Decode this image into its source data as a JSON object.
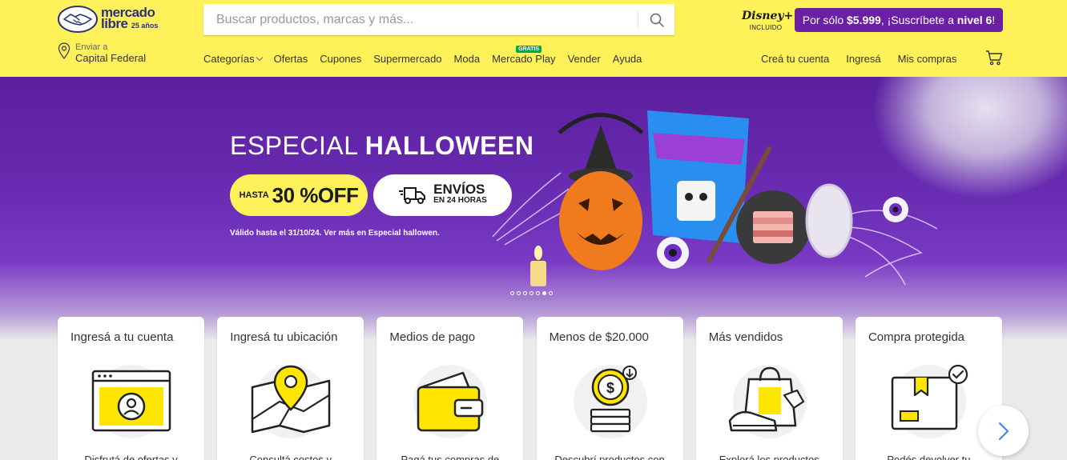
{
  "header": {
    "logo": {
      "line1": "mercado",
      "line2": "libre",
      "anniversary": "25 años"
    },
    "search": {
      "placeholder": "Buscar productos, marcas y más..."
    },
    "disney": {
      "brand": "Disney+",
      "tag": "INCLUIDO"
    },
    "promo": {
      "prefix": "Por sólo ",
      "price": "$5.999",
      "middle": ", ¡Suscríbete a ",
      "level": "nivel 6",
      "suffix": "!"
    },
    "location": {
      "label": "Enviar a",
      "value": "Capital Federal"
    },
    "nav": [
      {
        "label": "Categorías"
      },
      {
        "label": "Ofertas"
      },
      {
        "label": "Cupones"
      },
      {
        "label": "Supermercado"
      },
      {
        "label": "Moda"
      },
      {
        "label": "Mercado Play",
        "badge": "GRATIS"
      },
      {
        "label": "Vender"
      },
      {
        "label": "Ayuda"
      }
    ],
    "user_nav": [
      {
        "label": "Creá tu cuenta"
      },
      {
        "label": "Ingresá"
      },
      {
        "label": "Mis compras"
      }
    ]
  },
  "hero": {
    "title_light": "ESPECIAL ",
    "title_bold": "HALLOWEEN",
    "discount_prefix": "HASTA",
    "discount_value": "30 %OFF",
    "shipping_title": "ENVÍOS",
    "shipping_sub": "EN 24 HORAS",
    "note": "Válido hasta el 31/10/24. Ver más en Especial hallowen.",
    "slides": 7,
    "active_slide": 5
  },
  "cards": [
    {
      "title": "Ingresá a tu cuenta",
      "description": "Disfrutá de ofertas y",
      "icon": "browser-user-icon"
    },
    {
      "title": "Ingresá tu ubicación",
      "description": "Consultá costos y",
      "icon": "map-pin-icon"
    },
    {
      "title": "Medios de pago",
      "description": "Pagá tus compras de",
      "icon": "wallet-icon"
    },
    {
      "title": "Menos de $20.000",
      "description": "Descubrí productos con",
      "icon": "coins-icon"
    },
    {
      "title": "Más vendidos",
      "description": "Explorá los productos",
      "icon": "shopping-bag-sneaker-icon"
    },
    {
      "title": "Compra protegida",
      "description": "Podés devolver tu",
      "icon": "protected-box-icon"
    }
  ],
  "colors": {
    "header_bg": "#fff159",
    "promo_bg": "#6b1fa3",
    "hero_purple": "#5b1f9e",
    "accent_blue": "#3483fa",
    "icon_yellow": "#ffe600"
  }
}
